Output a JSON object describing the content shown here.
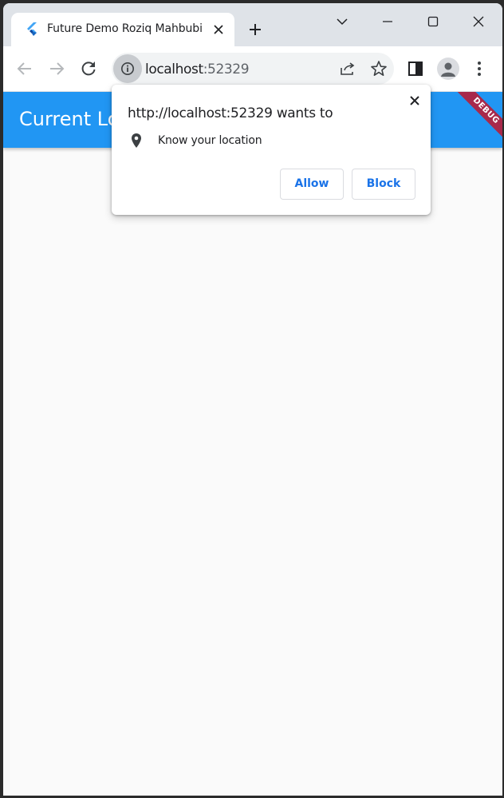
{
  "browser": {
    "tab": {
      "title": "Future Demo Roziq Mahbubi",
      "favicon": "flutter-logo-icon",
      "close_icon": "close-icon"
    },
    "new_tab_icon": "plus-icon",
    "window_controls": [
      "tab-search-icon",
      "minimize-icon",
      "maximize-icon",
      "close-window-icon"
    ],
    "toolbar": {
      "back_icon": "arrow-left-icon",
      "forward_icon": "arrow-right-icon",
      "reload_icon": "reload-icon",
      "site_info_icon": "info-icon",
      "url_host": "localhost",
      "url_port": ":52329",
      "share_icon": "share-icon",
      "bookmark_icon": "star-icon",
      "side_panel_icon": "side-panel-icon",
      "profile_icon": "person-icon",
      "menu_icon": "kebab-menu-icon"
    }
  },
  "app": {
    "appbar_title": "Current Location",
    "debug_banner": "DEBUG",
    "colors": {
      "appbar": "#2196f3",
      "banner": "#a8294b",
      "background": "#fafafa"
    }
  },
  "permission_popup": {
    "title": "http://localhost:52329 wants to",
    "permission_icon": "location-pin-icon",
    "permission_text": "Know your location",
    "allow_label": "Allow",
    "block_label": "Block",
    "accent": "#1a73e8"
  }
}
